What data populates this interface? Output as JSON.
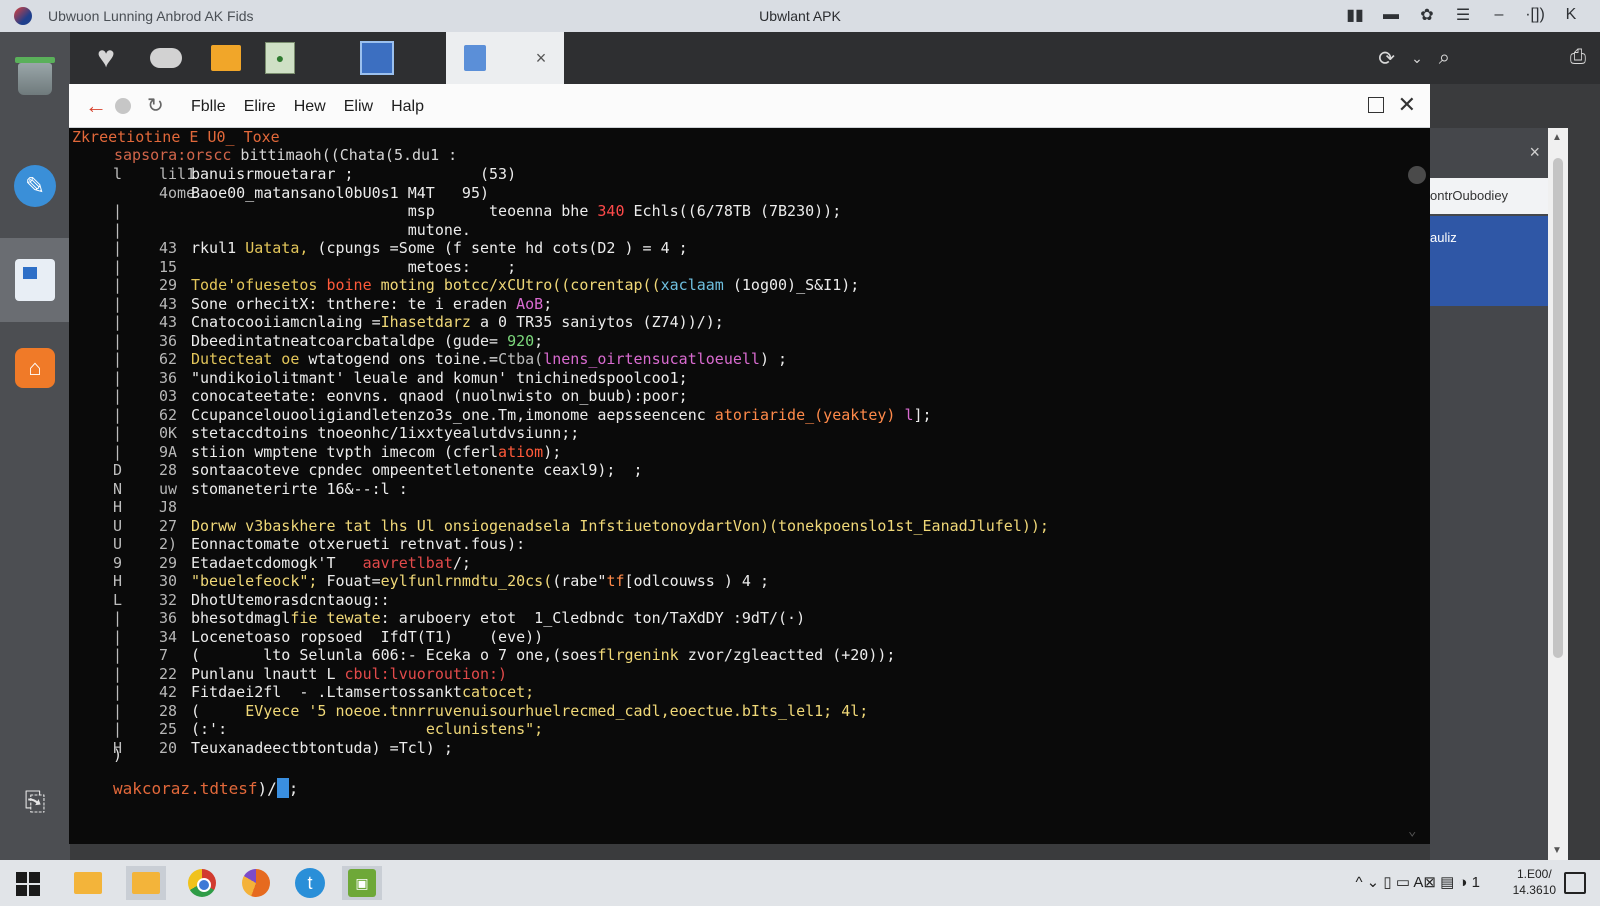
{
  "window": {
    "left_title": "Ubwuon Lunning Anbrod AK Fids",
    "center_title": "Ubwlant APK",
    "icons": [
      "book-icon",
      "wallet-icon",
      "gear-icon",
      "menu-icon",
      "minimize-icon",
      "maximize-icon",
      "collapse-icon"
    ],
    "controls": {
      "minimize": "–",
      "restore": "·[])",
      "collapse": "K"
    }
  },
  "tabstrip": {
    "active_tab_close": "×",
    "right_icons": [
      "history-icon",
      "chevron-down-icon",
      "search-icon"
    ]
  },
  "menubar": {
    "items": [
      "Fblle",
      "Elire",
      "Hew",
      "Eliw",
      "Halp"
    ]
  },
  "terminal": {
    "title": "Zkreetiotine E U0_ Toxe",
    "subtitle_kw": "sapsora:orscc",
    "subtitle_rest": " bittimaoh((Chata(5.du1 :",
    "gutter": [
      {
        "bar": "l",
        "num": "lil1"
      },
      {
        "bar": "",
        "num": "4ome"
      },
      {
        "bar": "|",
        "num": ""
      },
      {
        "bar": "|",
        "num": ""
      },
      {
        "bar": "|",
        "num": "43"
      },
      {
        "bar": "|",
        "num": "15"
      },
      {
        "bar": "|",
        "num": "29"
      },
      {
        "bar": "|",
        "num": "43"
      },
      {
        "bar": "|",
        "num": "43"
      },
      {
        "bar": "|",
        "num": "36"
      },
      {
        "bar": "|",
        "num": "62"
      },
      {
        "bar": "|",
        "num": "36"
      },
      {
        "bar": "|",
        "num": "03"
      },
      {
        "bar": "|",
        "num": "62"
      },
      {
        "bar": "|",
        "num": "0K"
      },
      {
        "bar": "|",
        "num": "9A"
      },
      {
        "bar": "D",
        "num": "28"
      },
      {
        "bar": "N",
        "num": "uw"
      },
      {
        "bar": "H",
        "num": "J8"
      },
      {
        "bar": "U",
        "num": "27"
      },
      {
        "bar": "U",
        "num": "2)"
      },
      {
        "bar": "9",
        "num": "29"
      },
      {
        "bar": "H",
        "num": "30"
      },
      {
        "bar": "L",
        "num": "32"
      },
      {
        "bar": "|",
        "num": "36"
      },
      {
        "bar": "|",
        "num": "34"
      },
      {
        "bar": "|",
        "num": "7"
      },
      {
        "bar": "|",
        "num": "22"
      },
      {
        "bar": "|",
        "num": "42"
      },
      {
        "bar": "|",
        "num": "28"
      },
      {
        "bar": "|",
        "num": "25"
      },
      {
        "bar": "H",
        "num": "20"
      }
    ],
    "lines": [
      [
        {
          "t": "banuisrmouetarar ;              (53)"
        }
      ],
      [
        {
          "t": "Baoe00_matansanol0bU0s1 M4T   95)"
        }
      ],
      [
        {
          "t": "                        msp      teoenna bhe "
        },
        {
          "t": "340",
          "c": "#ff4a4a"
        },
        {
          "t": " Echls((6/78TB (7B230));"
        }
      ],
      [
        {
          "t": "                        mutone."
        }
      ],
      [
        {
          "t": "rkul1 "
        },
        {
          "t": "Uatata,",
          "c": "#e3c65a"
        },
        {
          "t": " (cpungs =Some (f sente hd cots(D2 ) = 4 ;"
        }
      ],
      [
        {
          "t": "                        metoes:    ;"
        }
      ],
      [
        {
          "t": "Tode'ofuesetos ",
          "c": "#e3c65a"
        },
        {
          "t": "boine",
          "c": "#ff5a3a"
        },
        {
          "t": " moting botcc/xCUtro((corentap((",
          "c": "#f0d878"
        },
        {
          "t": "xaclaam",
          "c": "#6fc0e0"
        },
        {
          "t": " (1og00)_S&I1);"
        }
      ],
      [
        {
          "t": "Sone orhecitX: tnthere: te i eraden "
        },
        {
          "t": "AoB",
          "c": "#d96bd0"
        },
        {
          "t": ";"
        }
      ],
      [
        {
          "t": "Cnatocooiiamcnlaing ="
        },
        {
          "t": "Ihasetdarz",
          "c": "#f0d878"
        },
        {
          "t": " a 0 TR35 saniytos (Z74))/);"
        }
      ],
      [
        {
          "t": "Dbeedintatneatcoarcbataldpe (gude= "
        },
        {
          "t": "920",
          "c": "#7cd87c"
        },
        {
          "t": ";"
        }
      ],
      [
        {
          "t": "Dutecteat oe ",
          "c": "#e3c65a"
        },
        {
          "t": "wtatogend ons toine.="
        },
        {
          "t": "Ctba(",
          "c": "#bdbdbd"
        },
        {
          "t": "lnens_oirtensucatloeuell",
          "c": "#d96bd0"
        },
        {
          "t": ") ;"
        }
      ],
      [
        {
          "t": "\"undikoiolitmant' leuale and komun' tnichinedspoolcoo1;"
        }
      ],
      [
        {
          "t": "conocateetate: eonvns. qnaod (nuolnwisto on_buub):poor;"
        }
      ],
      [
        {
          "t": "Ccupancelouooligiandletenzo3s_one.Tm,imonome aepsseencenc "
        },
        {
          "t": "atoriaride_(yeaktey)",
          "c": "#ff8a4a"
        },
        {
          "t": " l",
          "c": "#d96bd0"
        },
        {
          "t": "];"
        }
      ],
      [
        {
          "t": "stetaccdtoins tnoeonhc/1ixxtyealutdvsiunn;;"
        }
      ],
      [
        {
          "t": "stiion wmptene tvpth imecom (cferl"
        },
        {
          "t": "atiom",
          "c": "#ff5a3a"
        },
        {
          "t": ");"
        }
      ],
      [
        {
          "t": "sontaacoteve cpndec ompeentetletonente ceaxl9);  ;"
        }
      ],
      [
        {
          "t": "stomaneterirte 16&--:l :"
        }
      ],
      [
        {
          "t": ""
        }
      ],
      [
        {
          "t": "Dorww v3baskhere tat lhs Ul onsiogenadsela InfstiuetonoydartVon",
          "c": "#f0d878"
        },
        {
          "t": ")(tonekpoenslo1st_EanadJlufel));",
          "c": "#f0d878"
        }
      ],
      [
        {
          "t": "Eonnactomate otxerueti retnvat.fous):"
        }
      ],
      [
        {
          "t": "Etadaetcdomogk'T   "
        },
        {
          "t": "aavretlbat",
          "c": "#e24a4a"
        },
        {
          "t": "/;"
        }
      ],
      [
        {
          "t": "\"beuelefeock\";",
          "c": "#f0d878"
        },
        {
          "t": " Fouat="
        },
        {
          "t": "eylfunlrnmdtu_20cs(",
          "c": "#f0d878"
        },
        {
          "t": "(rabe\""
        },
        {
          "t": "tf",
          "c": "#ff8a4a"
        },
        {
          "t": "[odlcouwss ) 4 ;"
        }
      ],
      [
        {
          "t": "DhotUtemorasdcntaoug::"
        }
      ],
      [
        {
          "t": "bhesotdmagl"
        },
        {
          "t": "fie tewate",
          "c": "#f0d878"
        },
        {
          "t": ": aruboery etot  1_Cledbndc ton/TaXdDY :9dT/(·)"
        }
      ],
      [
        {
          "t": "Locenetoaso ropsoed  IfdT(T1)    (eve))"
        }
      ],
      [
        {
          "t": "(       lto Selunla 606:- Eceka o 7 one,(soes"
        },
        {
          "t": "flrgenink",
          "c": "#f0d878"
        },
        {
          "t": " zvor/zgleactted (+20));"
        }
      ],
      [
        {
          "t": "Punlanu lnautt L "
        },
        {
          "t": "cbul:lvuoroution:)",
          "c": "#e24a4a"
        }
      ],
      [
        {
          "t": "Fitdaei2fl  - .Ltamsertossankt"
        },
        {
          "t": "catocet;",
          "c": "#f0d878"
        }
      ],
      [
        {
          "t": "(     ",
          "c": "#ececec"
        },
        {
          "t": "EVyece '5 noeoe.tnnrruvenuisourhuelrecmed_cadl,eoectue.bIts_lel1; 4l;",
          "c": "#f0d878"
        }
      ],
      [
        {
          "t": "(:':                      "
        },
        {
          "t": "eclunistens\";",
          "c": "#f0d878"
        }
      ],
      [
        {
          "t": "Teuxanadeectbtontuda) =Tcl) ;"
        }
      ]
    ],
    "closing_paren": ")",
    "prompt": "wakcoraz.tdtesf",
    "prompt_rest": ")/",
    "prompt_end": ";"
  },
  "right_panel": {
    "close": "×",
    "item": "ontrOubodiey",
    "selected": "auliz"
  },
  "taskbar": {
    "apps": [
      "folder-icon",
      "folder-icon",
      "chrome-icon",
      "firefox-icon",
      "twitter-icon",
      "terminal-icon"
    ],
    "tray_text": "^  ⌄  ▯  ▭  A⊠  ▤  ◑ 1",
    "clock_time": "1.E00/",
    "clock_date": "14.3610"
  }
}
